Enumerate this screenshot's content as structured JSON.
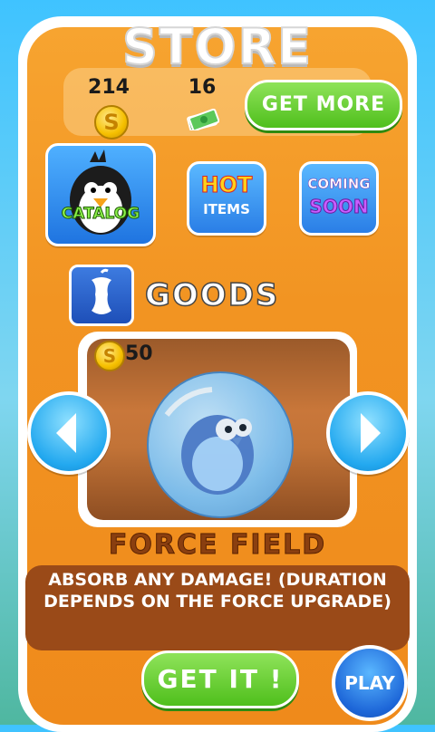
{
  "header": {
    "title": "STORE"
  },
  "currency": {
    "coins": "214",
    "cash": "16",
    "coin_symbol": "S",
    "get_more_label": "GET MORE"
  },
  "categories": {
    "catalog_label": "CATALOG",
    "hot_line1": "HOT",
    "hot_line2": "ITEMS",
    "soon_line1": "COMING",
    "soon_line2": "SOON"
  },
  "section": {
    "title": "GOODS"
  },
  "item": {
    "price": "50",
    "name": "FORCE FIELD",
    "description": "ABSORB ANY DAMAGE! (DURATION DEPENDS ON THE FORCE UPGRADE)"
  },
  "actions": {
    "get_it_label": "GET IT !",
    "play_label": "PLAY"
  },
  "icons": {
    "prev": "chevron-left-icon",
    "next": "chevron-right-icon",
    "goods": "apple-core-icon",
    "cash": "cash-icon",
    "coin": "coin-icon"
  },
  "colors": {
    "panel_orange": "#f29422",
    "button_green": "#4fbf1c",
    "arrow_blue": "#22a8ef"
  }
}
